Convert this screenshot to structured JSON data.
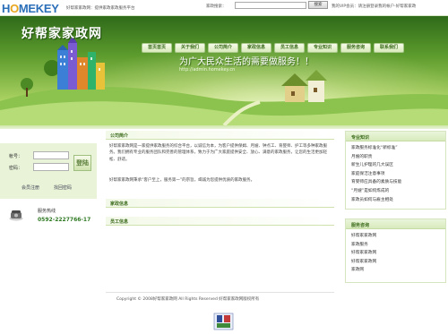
{
  "topbar": {
    "logo": {
      "ho": "H",
      "o": "O",
      "mekey": "MEKEY"
    },
    "welcome": "好帮家家政网：提供家政家政服务平台",
    "search_label": "家政搜索：",
    "search_value": "",
    "search_button": "搜索",
    "vip_text": "我的VIP会员：请注册登录我的帐户-好帮家家政"
  },
  "banner": {
    "site_title": "好帮家家政网",
    "slogan": "为广大民众生活的需要做服务！！",
    "url": "http://admin.homekey.cn",
    "nav": [
      "首页首页",
      "关于我们",
      "公司简介",
      "家政信息",
      "员工信息",
      "专业知识",
      "服务咨询",
      "联系我们"
    ]
  },
  "login": {
    "username_label": "帐号：",
    "password_label": "密码：",
    "login_button": "登陆",
    "register_link": "会员注册",
    "forgot_link": "找回密码"
  },
  "contact": {
    "title": "服务热线",
    "phone": "0592-2227766-17"
  },
  "main": {
    "sections": [
      {
        "title": "公司简介"
      },
      {
        "title": "家政信息"
      },
      {
        "title": "员工信息"
      }
    ],
    "intro": "好帮家家政网是一家提供家政服务的综合平台，以诚信为本，为客户提供保姆、月嫂、钟点工、育婴师、护工等多种家政服务。我们拥有专业的服务团队和完善的管理体系，致力于为广大家庭提供安全、放心、满意的家政服务，让您的生活更加轻松、舒适。",
    "intro2": "好帮家家政网秉承“客户至上，服务第一”的宗旨，竭诚为您提供优质的家政服务。"
  },
  "right": {
    "knowledge_title": "专业知识",
    "knowledge_items": [
      "家政服务标准化“新标准”",
      "月嫂的职责",
      "新生儿护理的几大误区",
      "家庭保洁注意事项",
      "育婴师应具备的素质与技能",
      "“月嫂”是如何炼成的",
      "家政员如何与雇主相处"
    ],
    "service_title": "服务咨询",
    "service_items": [
      "好帮家家政网",
      "家政服务",
      "好帮家家政网",
      "好帮家家政网",
      "家政网"
    ]
  },
  "footer": {
    "copyright": "Copyright © 2008好帮家家政网 All Rights Reserved 好帮家家政网版权所有"
  }
}
